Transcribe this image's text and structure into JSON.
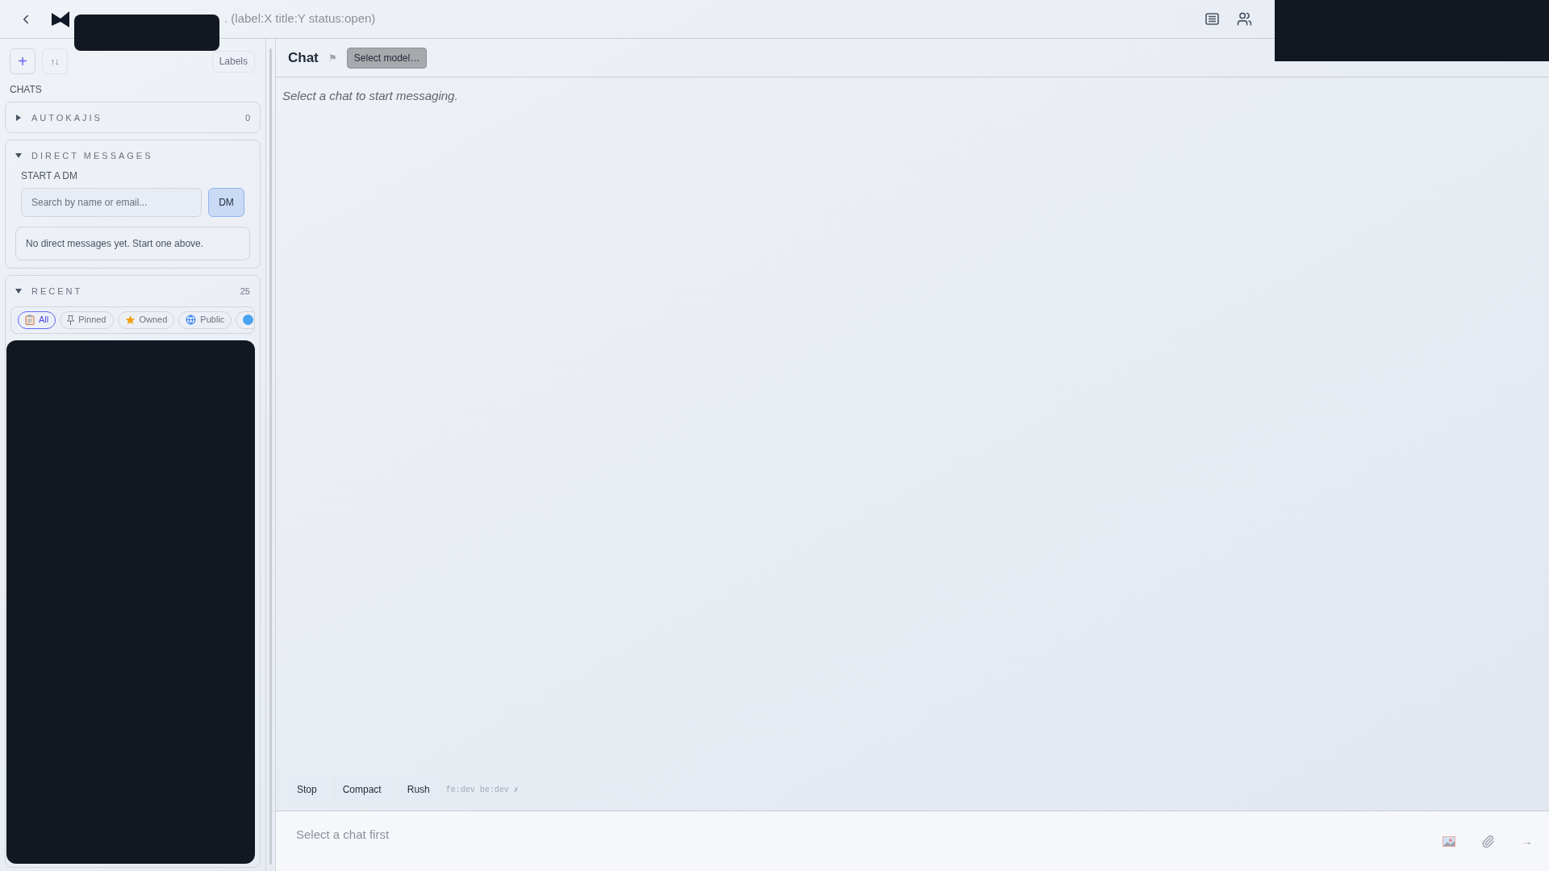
{
  "topbar": {
    "search_placeholder": ". (label:X title:Y status:open)"
  },
  "sidebar": {
    "new_button": "+",
    "sort_button": "↑↓",
    "labels_button": "Labels",
    "section_title": "CHATS",
    "groups": [
      {
        "kind": "autokajis",
        "title": "AUTOKAJIS",
        "count": "0",
        "expanded": false
      },
      {
        "kind": "dm",
        "title": "DIRECT MESSAGES",
        "expanded": true,
        "subtitle": "START A DM",
        "search_placeholder": "Search by name or email...",
        "button": "DM",
        "empty": "No direct messages yet. Start one above."
      },
      {
        "kind": "recent",
        "title": "RECENT",
        "count": "25",
        "expanded": true,
        "filters": [
          {
            "kind": "clipboard",
            "label": "All",
            "selected": true
          },
          {
            "kind": "pin",
            "label": "Pinned",
            "selected": false
          },
          {
            "kind": "star",
            "label": "Owned",
            "selected": false
          },
          {
            "kind": "globe",
            "label": "Public",
            "selected": false
          },
          {
            "kind": "dot",
            "selected": false
          }
        ]
      }
    ]
  },
  "chat": {
    "title": "Chat",
    "flag": "⚑",
    "model_button": "Select model…",
    "empty": "Select a chat to start messaging.",
    "actions": [
      "Stop",
      "Compact",
      "Rush"
    ],
    "env": "fe:dev be:dev ✗",
    "input_placeholder": "Select a chat first",
    "send": "→"
  }
}
